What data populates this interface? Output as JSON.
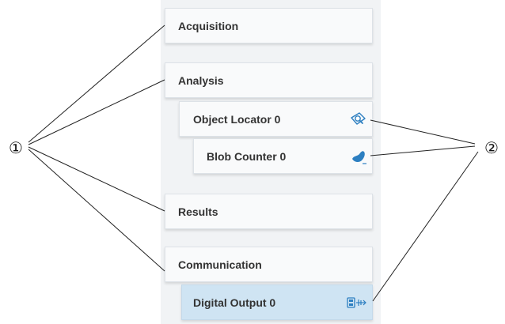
{
  "steps": [
    {
      "label": "Acquisition",
      "icon": null
    },
    {
      "label": "Analysis",
      "icon": null
    },
    {
      "label": "Object Locator 0",
      "icon": "object-locator-icon"
    },
    {
      "label": "Blob Counter 0",
      "icon": "blob-counter-icon"
    },
    {
      "label": "Results",
      "icon": null
    },
    {
      "label": "Communication",
      "icon": null
    },
    {
      "label": "Digital Output 0",
      "icon": "digital-output-icon"
    }
  ],
  "selected_step": "Digital Output 0",
  "callouts": {
    "one": "①",
    "two": "②"
  },
  "colors": {
    "panel_background": "#f1f3f5",
    "step_background": "#f9fafb",
    "selected_background": "#cfe4f3",
    "icon_blue": "#2d7fc1"
  }
}
